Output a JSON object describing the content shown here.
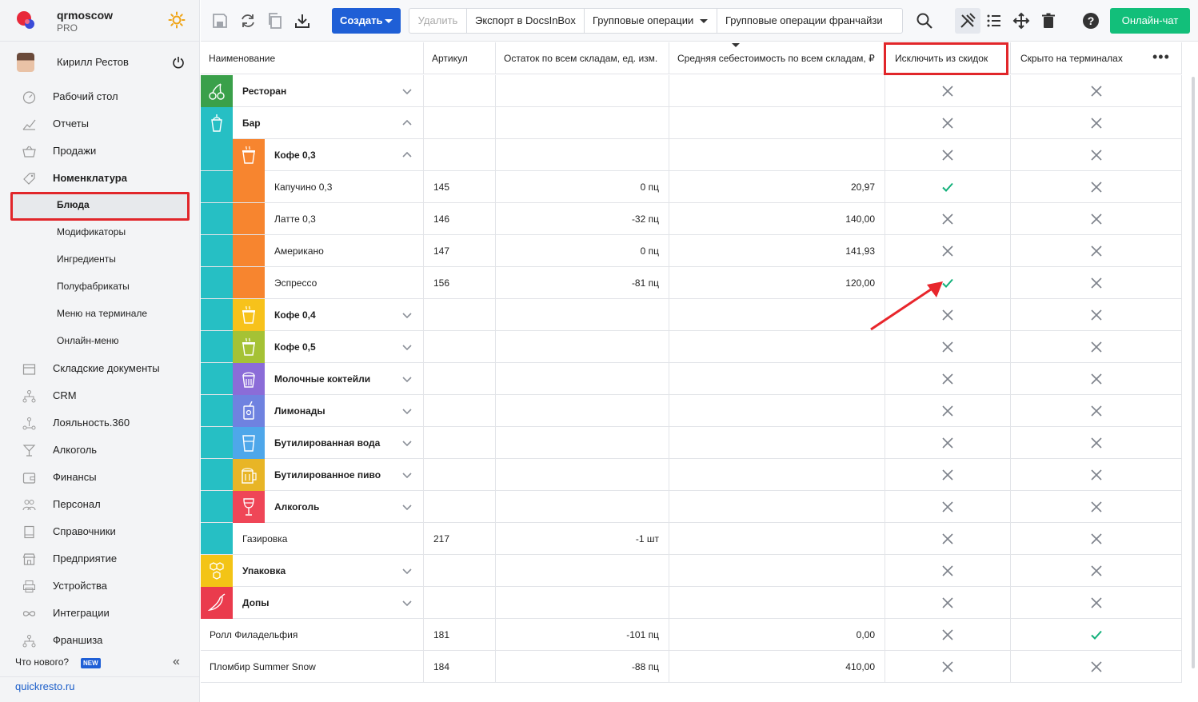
{
  "brand": {
    "name": "qrmoscow",
    "plan": "PRO"
  },
  "user": {
    "name": "Кирилл Рестов"
  },
  "nav": {
    "desk": "Рабочий стол",
    "reports": "Отчеты",
    "sales": "Продажи",
    "nomenclature": "Номенклатура",
    "dishes": "Блюда",
    "modifiers": "Модификаторы",
    "ingredients": "Ингредиенты",
    "semis": "Полуфабрикаты",
    "terminal_menu": "Меню на терминале",
    "online_menu": "Онлайн-меню",
    "warehouse": "Складские документы",
    "crm": "CRM",
    "loyalty": "Лояльность.360",
    "alcohol": "Алкоголь",
    "finance": "Финансы",
    "staff": "Персонал",
    "refs": "Справочники",
    "enterprise": "Предприятие",
    "devices": "Устройства",
    "integrations": "Интеграции",
    "franchise": "Франшиза"
  },
  "footer": {
    "whatsnew": "Что нового?",
    "new_badge": "NEW",
    "site": "quickresto.ru"
  },
  "toolbar": {
    "create": "Создать",
    "delete": "Удалить",
    "export": "Экспорт в DocsInBox",
    "group_ops": "Групповые операции",
    "group_ops_franchise": "Групповые операции франчайзи",
    "chat": "Онлайн-чат"
  },
  "columns": {
    "name": "Наименование",
    "article": "Артикул",
    "stock": "Остаток по всем складам, ед. изм.",
    "cost": "Средняя себестоимость по всем складам, ₽",
    "exclude": "Исключить из скидок",
    "hidden": "Скрыто на терминалах"
  },
  "rows": [
    {
      "name": "Ресторан",
      "article": "",
      "stock": "",
      "cost": "",
      "exclude": false,
      "hidden": false,
      "chevron": "down"
    },
    {
      "name": "Бар",
      "article": "",
      "stock": "",
      "cost": "",
      "exclude": false,
      "hidden": false,
      "chevron": "up"
    },
    {
      "name": "Кофе 0,3",
      "article": "",
      "stock": "",
      "cost": "",
      "exclude": false,
      "hidden": false,
      "chevron": "up"
    },
    {
      "name": "Капучино 0,3",
      "article": "145",
      "stock": "0 пц",
      "cost": "20,97",
      "exclude": true,
      "hidden": false
    },
    {
      "name": "Латте 0,3",
      "article": "146",
      "stock": "-32 пц",
      "cost": "140,00",
      "exclude": false,
      "hidden": false
    },
    {
      "name": "Американо",
      "article": "147",
      "stock": "0 пц",
      "cost": "141,93",
      "exclude": false,
      "hidden": false
    },
    {
      "name": "Эспрессо",
      "article": "156",
      "stock": "-81 пц",
      "cost": "120,00",
      "exclude": true,
      "hidden": false
    },
    {
      "name": "Кофе 0,4",
      "article": "",
      "stock": "",
      "cost": "",
      "exclude": false,
      "hidden": false,
      "chevron": "down"
    },
    {
      "name": "Кофе 0,5",
      "article": "",
      "stock": "",
      "cost": "",
      "exclude": false,
      "hidden": false,
      "chevron": "down"
    },
    {
      "name": "Молочные коктейли",
      "article": "",
      "stock": "",
      "cost": "",
      "exclude": false,
      "hidden": false,
      "chevron": "down"
    },
    {
      "name": "Лимонады",
      "article": "",
      "stock": "",
      "cost": "",
      "exclude": false,
      "hidden": false,
      "chevron": "down"
    },
    {
      "name": "Бутилированная вода",
      "article": "",
      "stock": "",
      "cost": "",
      "exclude": false,
      "hidden": false,
      "chevron": "down"
    },
    {
      "name": "Бутилированное пиво",
      "article": "",
      "stock": "",
      "cost": "",
      "exclude": false,
      "hidden": false,
      "chevron": "down"
    },
    {
      "name": "Алкоголь",
      "article": "",
      "stock": "",
      "cost": "",
      "exclude": false,
      "hidden": false,
      "chevron": "down"
    },
    {
      "name": "Газировка",
      "article": "217",
      "stock": "-1 шт",
      "cost": "",
      "exclude": false,
      "hidden": false
    },
    {
      "name": "Упаковка",
      "article": "",
      "stock": "",
      "cost": "",
      "exclude": false,
      "hidden": false,
      "chevron": "down"
    },
    {
      "name": "Допы",
      "article": "",
      "stock": "",
      "cost": "",
      "exclude": false,
      "hidden": false,
      "chevron": "down"
    },
    {
      "name": "Ролл Филадельфия",
      "article": "181",
      "stock": "-101 пц",
      "cost": "0,00",
      "exclude": false,
      "hidden": true
    },
    {
      "name": "Пломбир Summer Snow",
      "article": "184",
      "stock": "-88 пц",
      "cost": "410,00",
      "exclude": false,
      "hidden": false
    }
  ],
  "colors": {
    "accent": "#1f5fd6",
    "chat": "#12bf7a",
    "highlight": "#e1262a",
    "check": "#12b07a",
    "restaurant": "#3aa04a",
    "bar": "#26bfc4",
    "coffee03": "#f7852f",
    "coffee04": "#f7c21b",
    "coffee05": "#a5c235",
    "shakes": "#8b6cd8",
    "lemonades": "#6f82e0",
    "water": "#4ea7ea",
    "beer": "#e8b526",
    "alcohol": "#ef4657",
    "packaging": "#f3c416",
    "extras": "#ea3b4d"
  }
}
